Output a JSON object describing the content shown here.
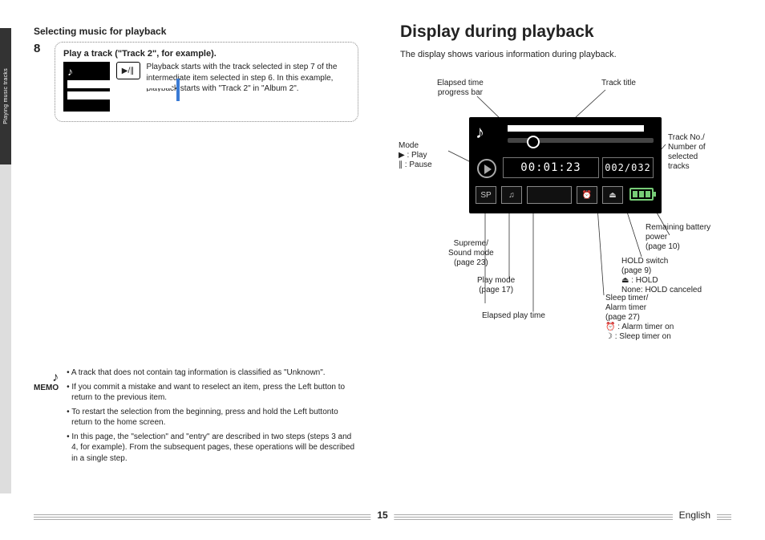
{
  "rail": {
    "section": "Playing music tracks"
  },
  "left": {
    "heading": "Selecting music for playback",
    "step_num": "8",
    "step_title": "Play a track (\"Track 2\", for example).",
    "step_text": "Playback starts with the track selected in step 7 of the intermediate item selected in step 6. In this example, playback starts with \"Track 2\" in \"Album 2\".",
    "play_btn": "▶/∥"
  },
  "memo": {
    "label": "MEMO",
    "items": [
      "A track that does not contain tag information is classified as \"Unknown\".",
      "If you commit a mistake and want to reselect an item, press the Left button to return to the previous item.",
      "To restart the selection from the beginning, press and hold the Left buttonto return to the home screen.",
      "In this page, the \"selection\" and \"entry\" are described in two steps (steps 3 and 4, for example). From the subsequent pages, these operations will be described in a single step."
    ]
  },
  "right": {
    "title": "Display during playback",
    "intro": "The display shows various information during playback.",
    "device": {
      "time": "00:01:23",
      "track_counter": "002/032"
    },
    "labels": {
      "elapsed_bar": "Elapsed time\nprogress bar",
      "track_title": "Track title",
      "mode_head": "Mode",
      "mode_play": "▶ : Play",
      "mode_pause": "∥ : Pause",
      "track_no": "Track No./\nNumber of\nselected tracks",
      "supreme": "Supreme/\nSound mode\n(page 23)",
      "play_mode": "Play mode\n(page 17)",
      "elapsed_play": "Elapsed play time",
      "battery": "Remaining battery\npower\n(page 10)",
      "hold": "HOLD switch\n(page 9)",
      "hold_on": "⏏ : HOLD",
      "hold_off": "None: HOLD canceled",
      "sleep": "Sleep timer/\nAlarm timer\n(page 27)",
      "alarm_on": "⏰ : Alarm timer on",
      "sleep_on": "☽ : Sleep timer on"
    }
  },
  "footer": {
    "page": "15",
    "lang": "English"
  }
}
